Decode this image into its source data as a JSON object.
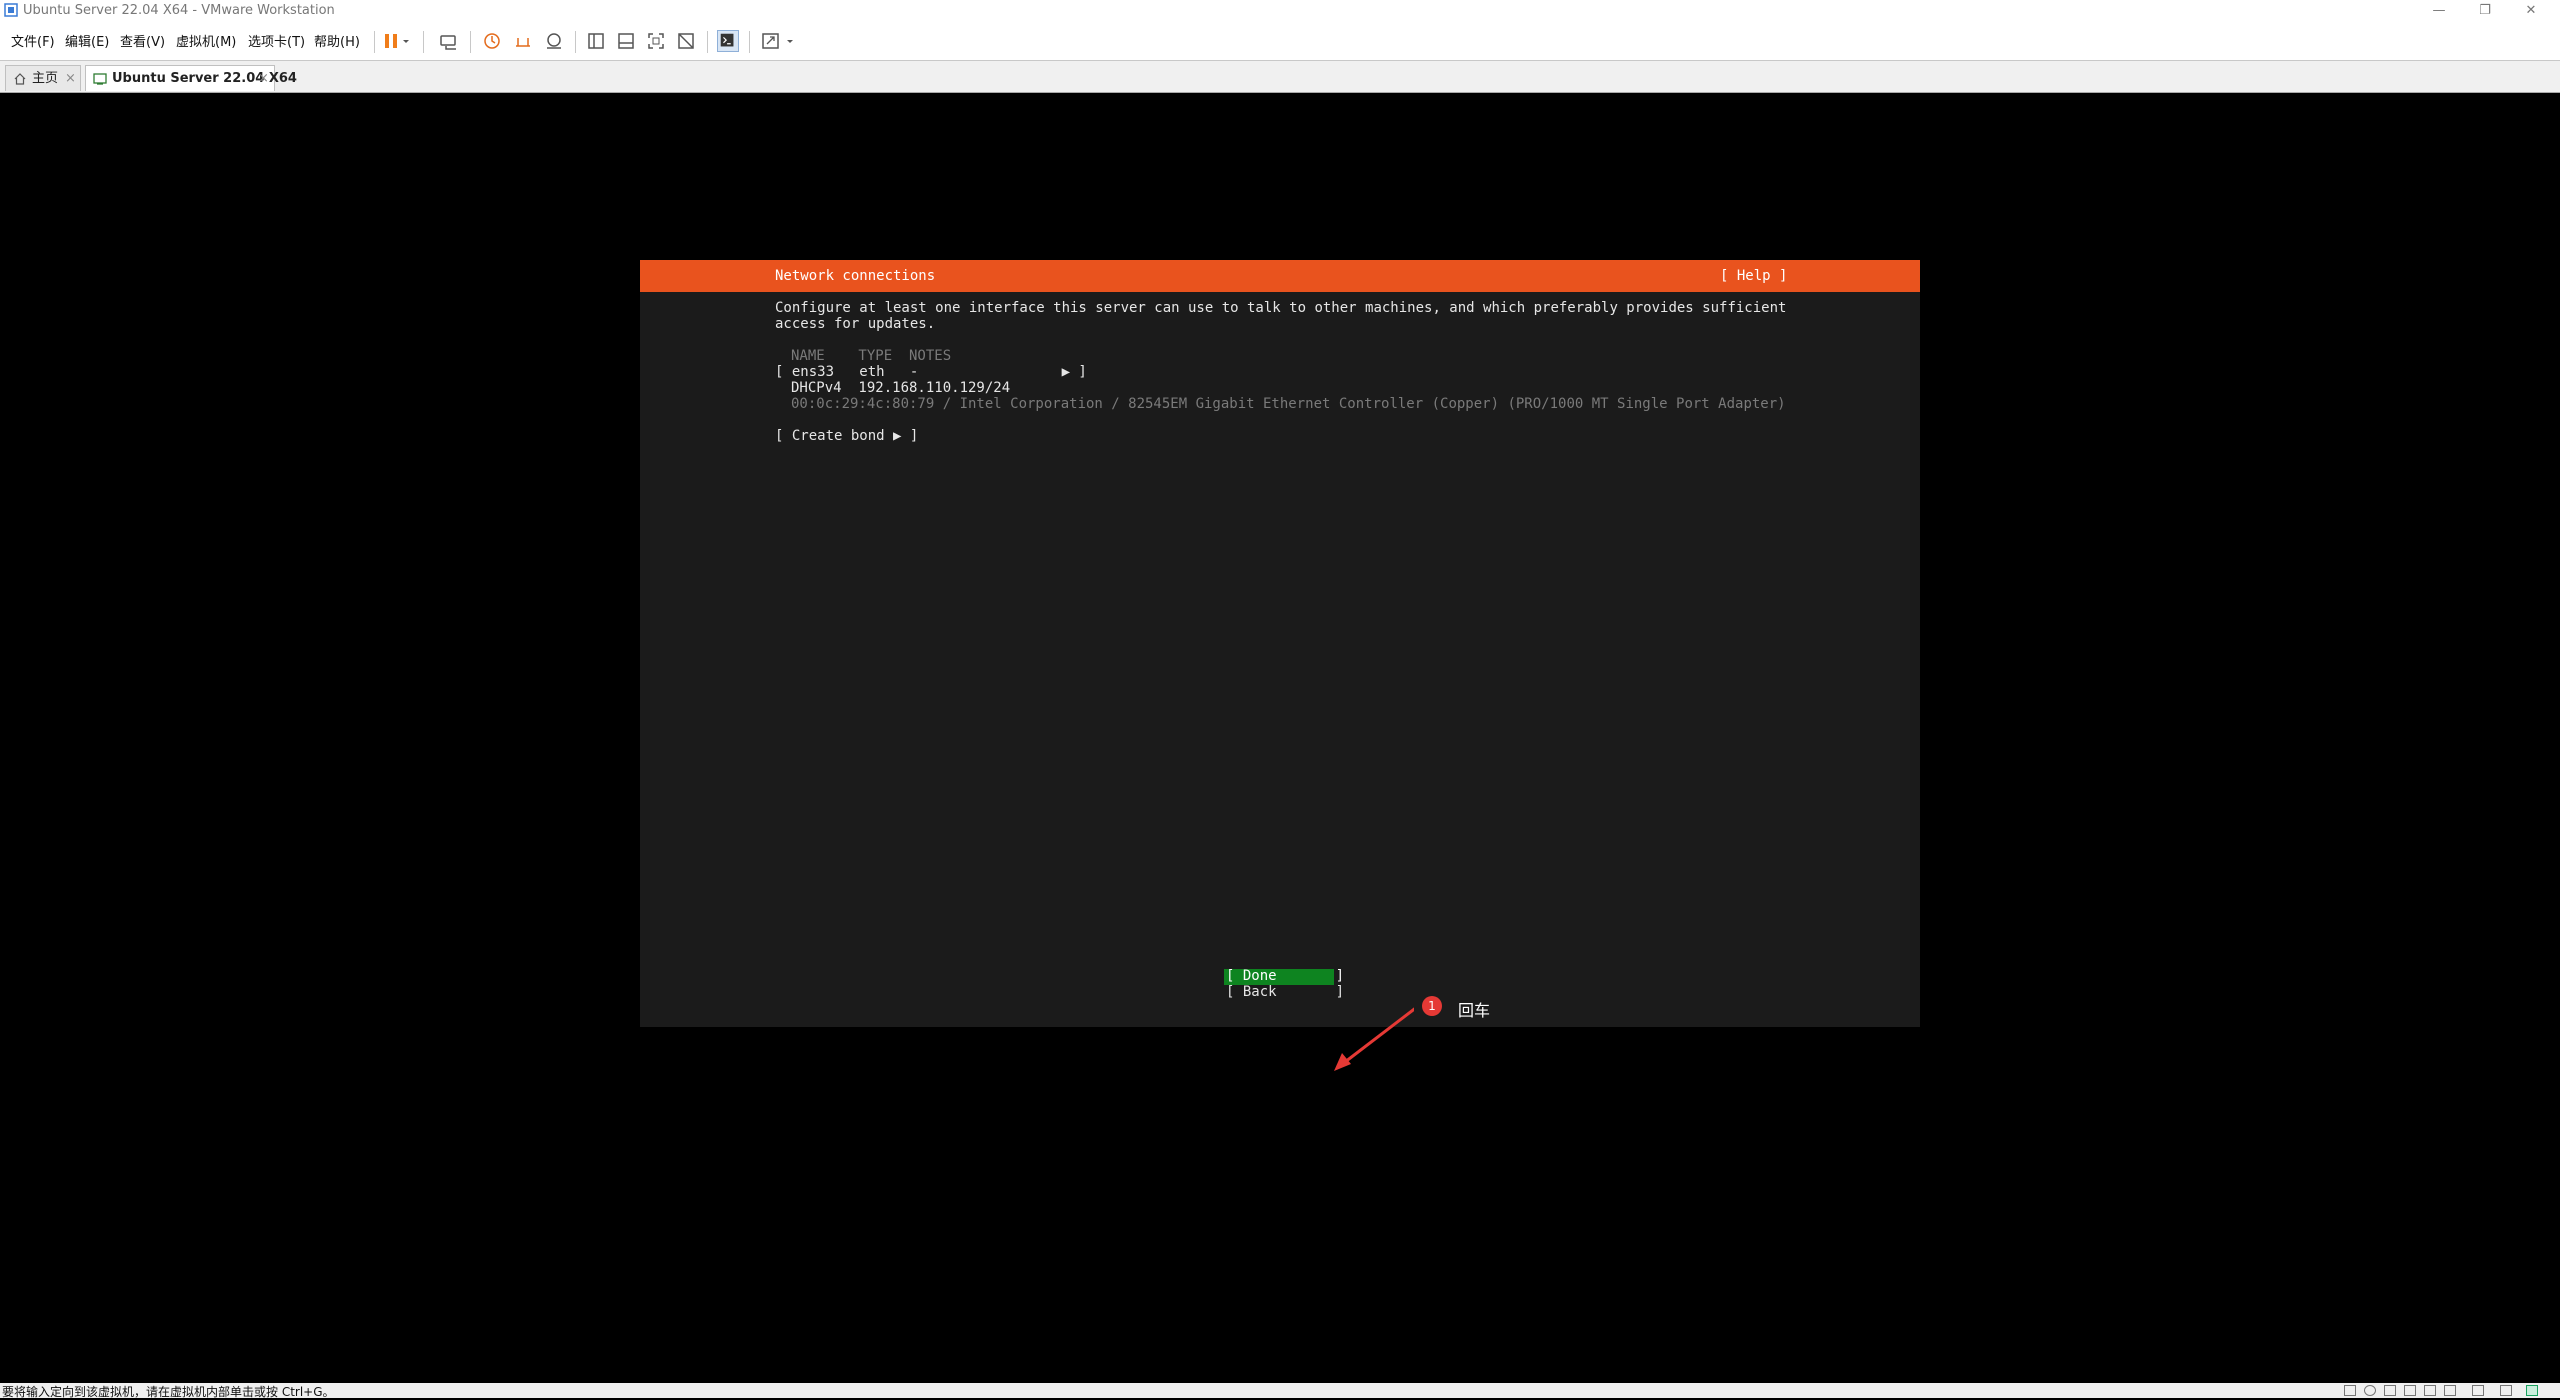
{
  "window": {
    "title": "Ubuntu Server 22.04 X64 - VMware Workstation",
    "minimize": "—",
    "restore": "❐",
    "close": "✕"
  },
  "menu": {
    "items": [
      "文件(F)",
      "编辑(E)",
      "查看(V)",
      "虚拟机(M)",
      "选项卡(T)",
      "帮助(H)"
    ]
  },
  "toolbar": {
    "icons": [
      "pause-icon",
      "send-ctrl-alt-del-icon",
      "snapshot-icon",
      "revert-snapshot-icon",
      "snapshot-manager-icon",
      "sidebar-icon",
      "thumbnail-bar-icon",
      "fullscreen-icon",
      "unity-icon",
      "console-view-icon",
      "stretch-icon"
    ]
  },
  "tabs": [
    {
      "label": "主页",
      "icon": "home-icon",
      "active": false
    },
    {
      "label": "Ubuntu Server 22.04 X64",
      "icon": "vm-icon",
      "active": true
    }
  ],
  "installer": {
    "header_title": "Network connections",
    "help": "[ Help ]",
    "description_line1": "Configure at least one interface this server can use to talk to other machines, and which preferably provides sufficient",
    "description_line2": "access for updates.",
    "table_header": "NAME    TYPE  NOTES",
    "iface_row": "[ ens33   eth   -                 ▶ ]",
    "dhcp_row": "DHCPv4  192.168.110.129/24",
    "hw_row": "00:0c:29:4c:80:79 / Intel Corporation / 82545EM Gigabit Ethernet Controller (Copper) (PRO/1000 MT Single Port Adapter)",
    "create_bond": "[ Create bond ▶ ]",
    "done": "[ Done       ]",
    "back": "[ Back       ]",
    "colors": {
      "header": "#e9531e",
      "done_bg": "#0e8420",
      "background": "#1b1b1b"
    }
  },
  "annotation": {
    "badge": "1",
    "label": "回车"
  },
  "statusbar": {
    "message": "要将输入定向到该虚拟机，请在虚拟机内部单击或按 Ctrl+G。"
  }
}
